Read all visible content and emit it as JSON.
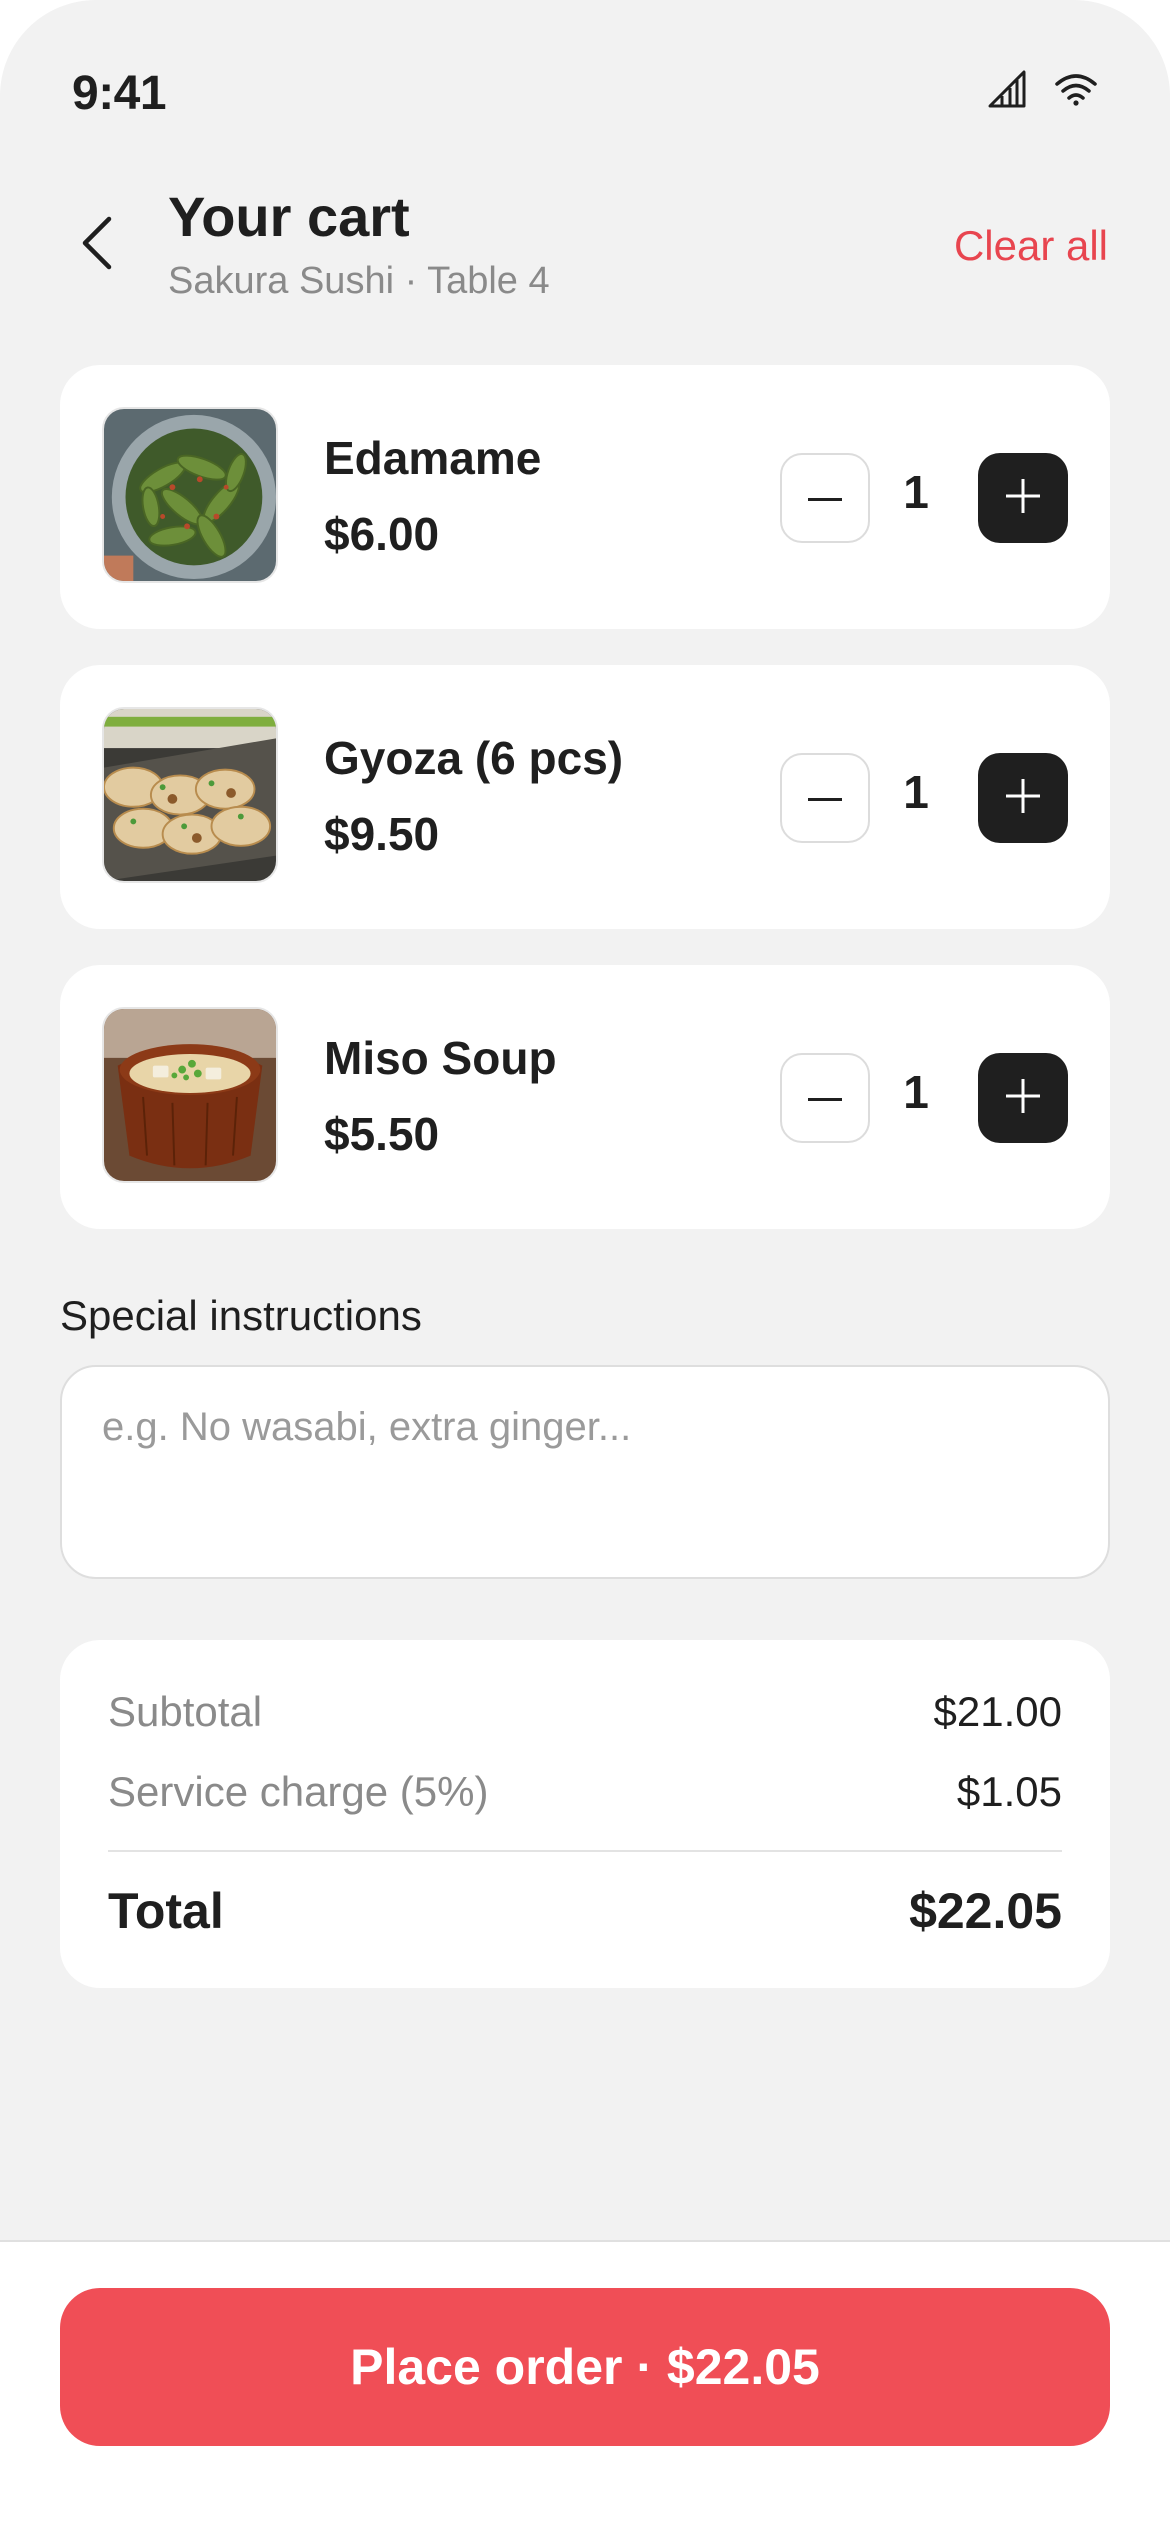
{
  "status_bar": {
    "time": "9:41",
    "icons": [
      "signal-icon",
      "wifi-icon"
    ]
  },
  "header": {
    "back_icon": "chevron-left-icon",
    "title": "Your cart",
    "subtitle": "Sakura Sushi · Table 4",
    "clear_all": "Clear all"
  },
  "items": [
    {
      "name": "Edamame",
      "price": "$6.00",
      "quantity": "1",
      "image": "edamame-photo"
    },
    {
      "name": "Gyoza (6 pcs)",
      "price": "$9.50",
      "quantity": "1",
      "image": "gyoza-photo"
    },
    {
      "name": "Miso Soup",
      "price": "$5.50",
      "quantity": "1",
      "image": "miso-soup-photo"
    }
  ],
  "instructions": {
    "label": "Special instructions",
    "value": "",
    "placeholder": "e.g. No wasabi, extra ginger..."
  },
  "summary": {
    "subtotal_label": "Subtotal",
    "subtotal_value": "$21.00",
    "service_label": "Service charge (5%)",
    "service_value": "$1.05",
    "total_label": "Total",
    "total_value": "$22.05"
  },
  "cta": {
    "label": "Place order · $22.05"
  },
  "colors": {
    "accent": "#f04e56",
    "clear_all": "#e8454f",
    "dark_button": "#1f1f1f",
    "background": "#f2f2f2"
  }
}
